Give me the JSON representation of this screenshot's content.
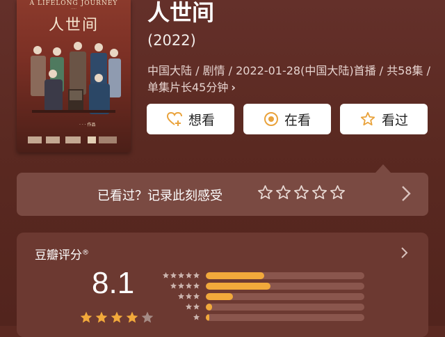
{
  "poster": {
    "en_title": "A LIFELONG JOURNEY",
    "title": "人世间",
    "platform": "爱奇艺"
  },
  "movie": {
    "title": "人世间",
    "year": "(2022)",
    "meta": "中国大陆 / 剧情 / 2022-01-28(中国大陆)首播 / 共58集 / 单集片长45分钟"
  },
  "actions": {
    "want_label": "想看",
    "watching_label": "在看",
    "watched_label": "看过"
  },
  "record": {
    "label": "已看过？记录此刻感受",
    "stars_count": 5
  },
  "rating": {
    "label": "豆瓣评分",
    "registered_mark": "®",
    "score": "8.1",
    "score_stars_filled": 4,
    "histogram": [
      {
        "stars": 5,
        "fraction": 0.37
      },
      {
        "stars": 4,
        "fraction": 0.41
      },
      {
        "stars": 3,
        "fraction": 0.17
      },
      {
        "stars": 2,
        "fraction": 0.04
      },
      {
        "stars": 1,
        "fraction": 0.02
      }
    ]
  },
  "colors": {
    "background": "#5b2921",
    "panel": "#7a4a42",
    "accent": "#f2a93b",
    "watching_icon": "#e9a23b"
  }
}
